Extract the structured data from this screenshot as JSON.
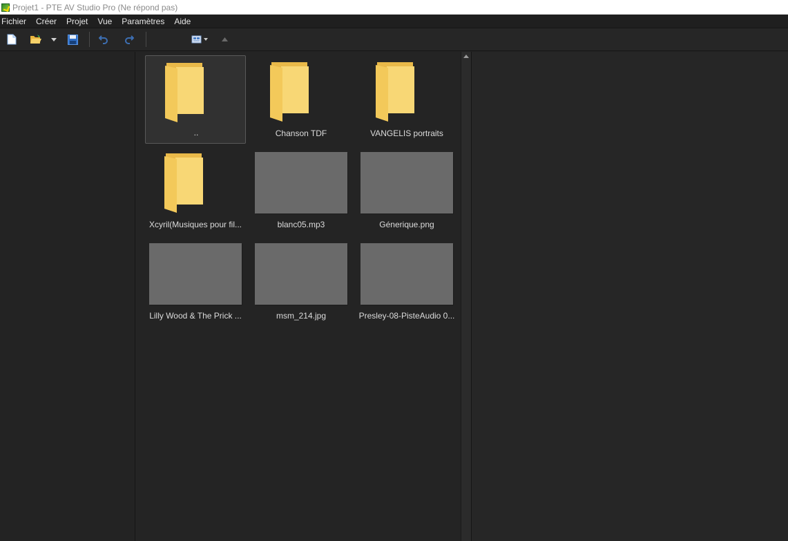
{
  "window": {
    "title": "Projet1 - PTE AV Studio Pro (Ne répond pas)"
  },
  "menu": {
    "items": [
      "Fichier",
      "Créer",
      "Projet",
      "Vue",
      "Paramètres",
      "Aide"
    ]
  },
  "toolbar": {
    "buttons": [
      "new-icon",
      "open-folder-icon",
      "dropdown-arrow-icon",
      "save-icon",
      "undo-icon",
      "redo-icon",
      "view-mode-icon",
      "up-arrow-icon"
    ]
  },
  "browser": {
    "items": [
      {
        "label": "..",
        "type": "folder"
      },
      {
        "label": "Chanson TDF",
        "type": "folder"
      },
      {
        "label": "VANGELIS  portraits",
        "type": "folder"
      },
      {
        "label": "Xcyril(Musiques pour fil...",
        "type": "folder"
      },
      {
        "label": "blanc05.mp3",
        "type": "file"
      },
      {
        "label": "Génerique.png",
        "type": "file"
      },
      {
        "label": "Lilly Wood & The Prick ...",
        "type": "file"
      },
      {
        "label": "msm_214.jpg",
        "type": "file"
      },
      {
        "label": "Presley-08-PisteAudio 0...",
        "type": "file"
      }
    ]
  },
  "colors": {
    "folder": "#f8d775",
    "thumbnail": "#6a6a6a",
    "background": "#232323"
  }
}
